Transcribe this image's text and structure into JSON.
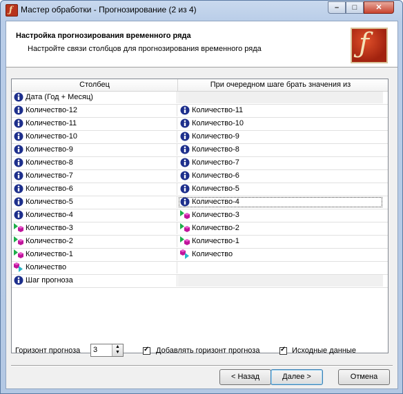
{
  "window": {
    "title": "Мастер обработки - Прогнозирование (2 из 4)"
  },
  "header": {
    "title": "Настройка прогнозирования временного ряда",
    "subtitle": "Настройте связи столбцов для прогнозирования временного ряда"
  },
  "grid": {
    "columns": [
      "Столбец",
      "При очередном шаге брать значения из"
    ],
    "rows": [
      {
        "c1": "Дата (Год + Месяц)",
        "i1": "info",
        "c2": "",
        "i2": ""
      },
      {
        "c1": "Количество-12",
        "i1": "info",
        "c2": "Количество-11",
        "i2": "info"
      },
      {
        "c1": "Количество-11",
        "i1": "info",
        "c2": "Количество-10",
        "i2": "info"
      },
      {
        "c1": "Количество-10",
        "i1": "info",
        "c2": "Количество-9",
        "i2": "info"
      },
      {
        "c1": "Количество-9",
        "i1": "info",
        "c2": "Количество-8",
        "i2": "info"
      },
      {
        "c1": "Количество-8",
        "i1": "info",
        "c2": "Количество-7",
        "i2": "info"
      },
      {
        "c1": "Количество-7",
        "i1": "info",
        "c2": "Количество-6",
        "i2": "info"
      },
      {
        "c1": "Количество-6",
        "i1": "info",
        "c2": "Количество-5",
        "i2": "info"
      },
      {
        "c1": "Количество-5",
        "i1": "info",
        "c2": "Количество-4",
        "i2": "info"
      },
      {
        "c1": "Количество-4",
        "i1": "info",
        "c2": "Количество-3",
        "i2": "input"
      },
      {
        "c1": "Количество-3",
        "i1": "input",
        "c2": "Количество-2",
        "i2": "input"
      },
      {
        "c1": "Количество-2",
        "i1": "input",
        "c2": "Количество-1",
        "i2": "input"
      },
      {
        "c1": "Количество-1",
        "i1": "input",
        "c2": "Количество",
        "i2": "output"
      },
      {
        "c1": "Количество",
        "i1": "output",
        "c2": "",
        "i2": ""
      },
      {
        "c1": "Шаг прогноза",
        "i1": "info",
        "c2": "",
        "i2": ""
      }
    ]
  },
  "controls": {
    "horizon_label": "Горизонт прогноза",
    "horizon_value": "3",
    "add_horizon_label": "Добавлять горизонт прогноза",
    "add_horizon_checked": true,
    "source_data_label": "Исходные данные",
    "source_data_checked": true
  },
  "buttons": {
    "back": "< Назад",
    "next": "Далее >",
    "cancel": "Отмена"
  }
}
